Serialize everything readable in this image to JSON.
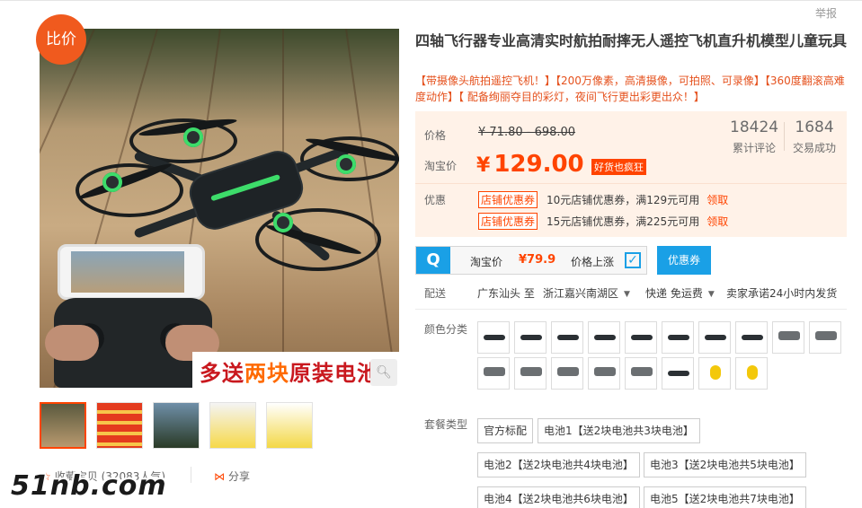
{
  "header": {
    "report": "举报"
  },
  "badge": {
    "compare": "比价"
  },
  "gallery": {
    "banner_part1": "多送",
    "banner_highlight": "两块",
    "banner_part2": "原装电池",
    "zoom_icon": "magnifier-icon",
    "thumbnails": [
      "main-drone",
      "battery-promo",
      "drone-sky",
      "inductive-heli",
      "minion-heli"
    ]
  },
  "actions": {
    "collect": "收藏宝贝 (32083人气)",
    "share": "分享"
  },
  "watermark": "51nb.com",
  "product": {
    "title": "四轴飞行器专业高清实时航拍耐摔无人遥控飞机直升机模型儿童玩具",
    "subtitle": "【带摄像头航拍遥控飞机！】【200万像素，高清摄像，可拍照、可录像】【360度翻滚高难度动作】【 配备绚丽夺目的彩灯，夜间飞行更出彩更出众！】"
  },
  "price": {
    "label": "价格",
    "original": "¥ 71.80 - 698.00",
    "tb_label": "淘宝价",
    "currency": "¥",
    "tb_value": "129.00",
    "good_tag": "好货也疯狂",
    "reviews_num": "18424",
    "reviews_label": "累计评论",
    "deals_num": "1684",
    "deals_label": "交易成功"
  },
  "promo": {
    "label": "优惠",
    "coupons": [
      {
        "tag": "店铺优惠券",
        "text": "10元店铺优惠券，满129元可用",
        "action": "领取"
      },
      {
        "tag": "店铺优惠券",
        "text": "15元店铺优惠券，满225元可用",
        "action": "领取"
      }
    ]
  },
  "compare_bar": {
    "icon": "Q",
    "label": "淘宝价",
    "value": "¥79.9",
    "rise": "价格上涨",
    "button": "优惠券"
  },
  "shipping": {
    "label": "配送",
    "from": "广东汕头 至",
    "to": "浙江嘉兴南湖区",
    "method": "快递 免运费",
    "promise": "卖家承诺24小时内发货"
  },
  "color_label": "颜色分类",
  "package_label": "套餐类型",
  "packages": [
    "官方标配",
    "电池1【送2块电池共3块电池】",
    "电池2【送2块电池共4块电池】",
    "电池3【送2块电池共5块电池】",
    "电池4【送2块电池共6块电池】",
    "电池5【送2块电池共7块电池】"
  ]
}
